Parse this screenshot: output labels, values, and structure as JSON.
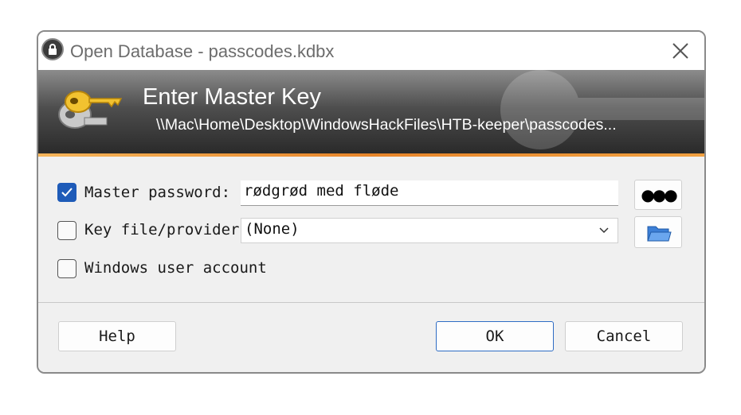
{
  "window": {
    "title": "Open Database - passcodes.kdbx"
  },
  "banner": {
    "title": "Enter Master Key",
    "path": "\\\\Mac\\Home\\Desktop\\WindowsHackFiles\\HTB-keeper\\passcodes..."
  },
  "form": {
    "master_password": {
      "checked": true,
      "label": "Master password:",
      "value": "rødgrød med fløde"
    },
    "key_file": {
      "checked": false,
      "label": "Key file/provider:",
      "selected": "(None)"
    },
    "windows_account": {
      "checked": false,
      "label": "Windows user account"
    }
  },
  "buttons": {
    "show_password": "●●●",
    "help": "Help",
    "ok": "OK",
    "cancel": "Cancel"
  },
  "colors": {
    "accent": "#1e5bb8",
    "banner_stripe": "#e7852a"
  },
  "icons": {
    "app": "keepass-lock-icon",
    "close": "close-icon",
    "banner": "key-icon",
    "browse": "folder-icon",
    "dropdown": "chevron-down-icon"
  }
}
